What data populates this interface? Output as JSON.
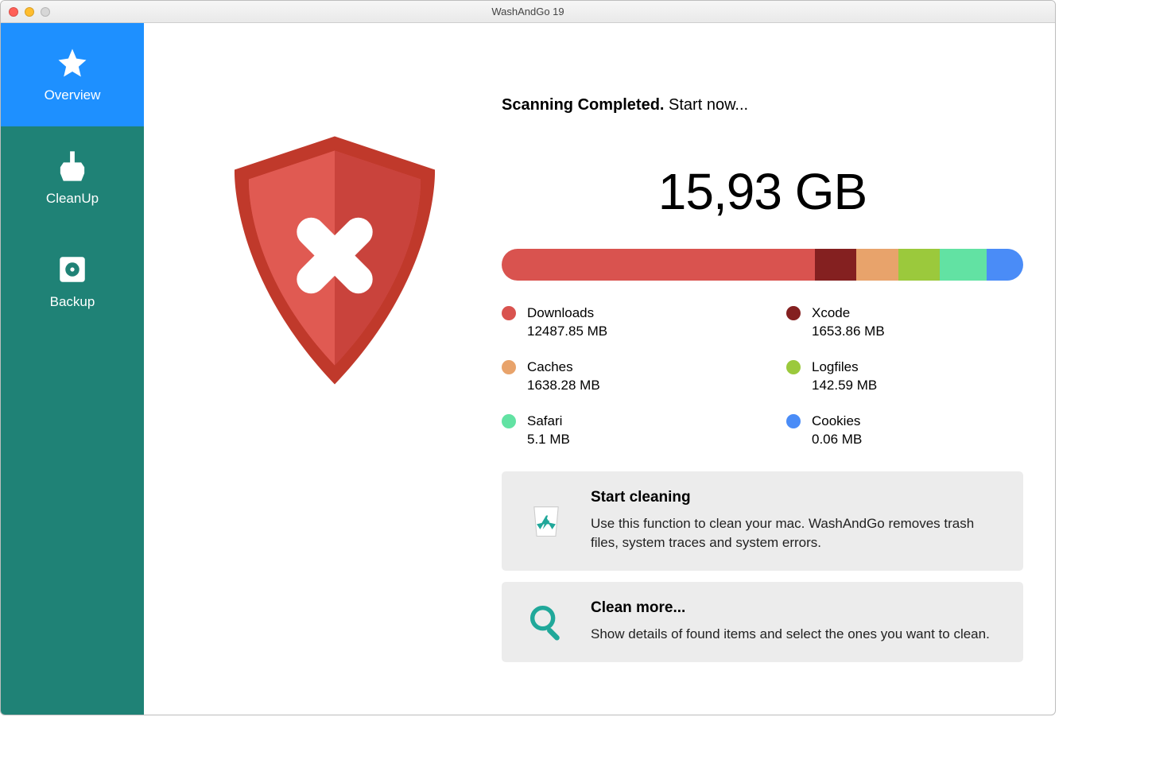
{
  "window_title": "WashAndGo 19",
  "sidebar": {
    "items": [
      {
        "label": "Overview",
        "icon": "star-icon",
        "active": true
      },
      {
        "label": "CleanUp",
        "icon": "broom-icon",
        "active": false
      },
      {
        "label": "Backup",
        "icon": "disk-icon",
        "active": false
      }
    ]
  },
  "status": {
    "bold": "Scanning Completed.",
    "rest": " Start now..."
  },
  "total_size": "15,93 GB",
  "categories": [
    {
      "name": "Downloads",
      "size": "12487.85 MB",
      "color": "#d9534f",
      "pct": 60.0
    },
    {
      "name": "Xcode",
      "size": "1653.86 MB",
      "color": "#842020",
      "pct": 8.0
    },
    {
      "name": "Caches",
      "size": "1638.28 MB",
      "color": "#e8a36b",
      "pct": 8.0
    },
    {
      "name": "Logfiles",
      "size": "142.59 MB",
      "color": "#9bc93c",
      "pct": 8.0
    },
    {
      "name": "Safari",
      "size": "5.1 MB",
      "color": "#62e2a3",
      "pct": 9.0
    },
    {
      "name": "Cookies",
      "size": "0.06 MB",
      "color": "#4a8cf7",
      "pct": 7.0
    }
  ],
  "cards": {
    "start": {
      "title": "Start cleaning",
      "desc": "Use this function to clean your mac. WashAndGo removes trash files, system traces and system errors."
    },
    "more": {
      "title": "Clean more...",
      "desc": "Show details of found items and select the ones you want to clean."
    }
  }
}
